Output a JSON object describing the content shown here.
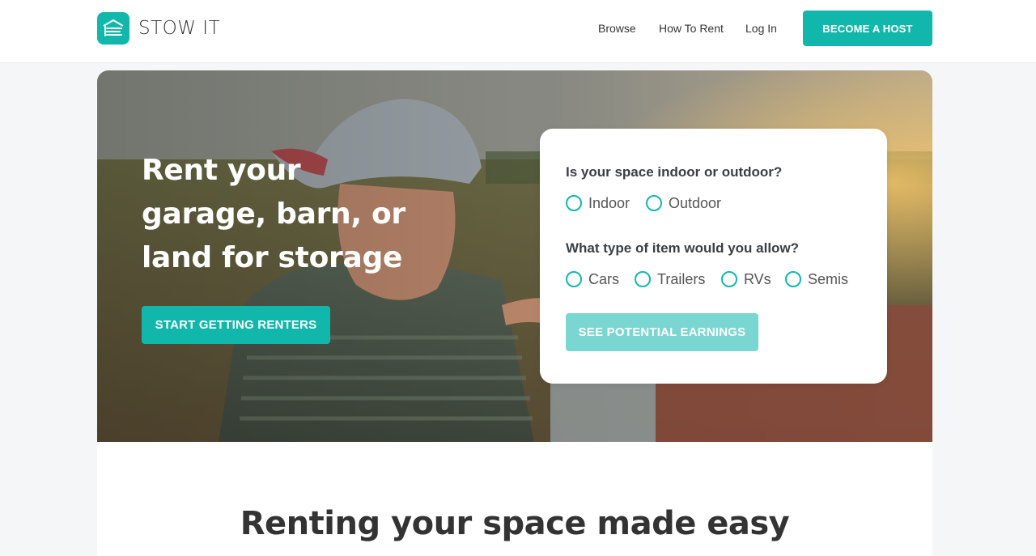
{
  "brand": {
    "name": "STOW IT",
    "accent": "#12b7ac"
  },
  "nav": {
    "links": [
      "Browse",
      "How To Rent",
      "Log In"
    ],
    "host_button": "BECOME A HOST"
  },
  "hero": {
    "title": "Rent your garage, barn, or land for storage",
    "cta": "START GETTING RENTERS"
  },
  "form": {
    "q1": "Is your space indoor or outdoor?",
    "q1_options": [
      "Indoor",
      "Outdoor"
    ],
    "q2": "What type of item would you allow?",
    "q2_options": [
      "Cars",
      "Trailers",
      "RVs",
      "Semis"
    ],
    "submit": "SEE POTENTIAL EARNINGS"
  },
  "section": {
    "title": "Renting your space made easy"
  }
}
